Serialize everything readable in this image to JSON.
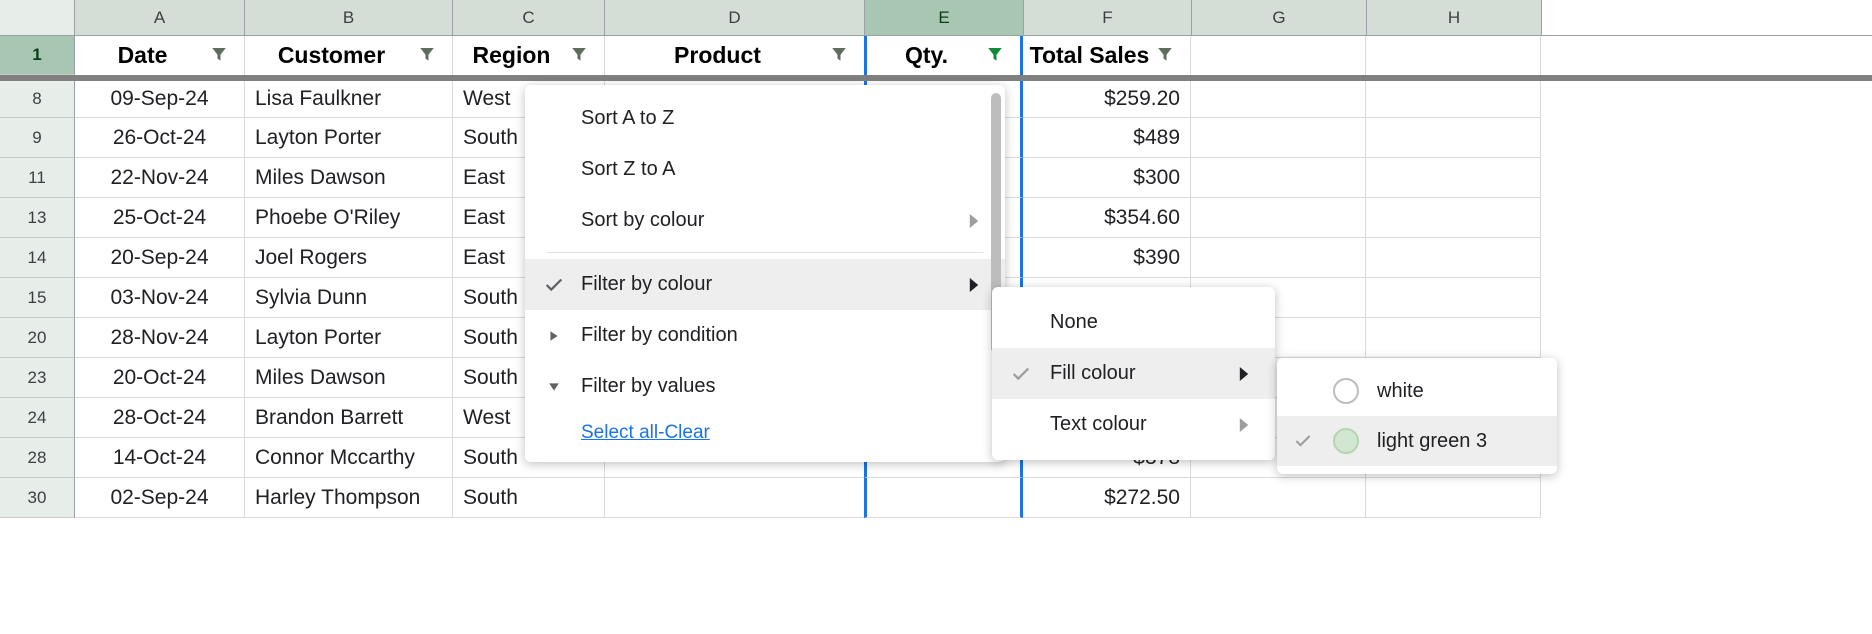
{
  "columns": [
    "A",
    "B",
    "C",
    "D",
    "E",
    "F",
    "G",
    "H"
  ],
  "column_widths": [
    "w-a",
    "w-b",
    "w-c",
    "w-d",
    "w-e",
    "w-f",
    "w-g",
    "w-h"
  ],
  "selected_col_index": 4,
  "header_row_num": "1",
  "headers": [
    {
      "label": "Date",
      "filter": "normal"
    },
    {
      "label": "Customer",
      "filter": "normal"
    },
    {
      "label": "Region",
      "filter": "normal"
    },
    {
      "label": "Product",
      "filter": "normal"
    },
    {
      "label": "Qty.",
      "filter": "active"
    },
    {
      "label": "Total Sales",
      "filter": "normal"
    }
  ],
  "rows": [
    {
      "n": "8",
      "date": "09-Sep-24",
      "customer": "Lisa Faulkner",
      "region": "West",
      "total": "$259.20"
    },
    {
      "n": "9",
      "date": "26-Oct-24",
      "customer": "Layton Porter",
      "region": "South",
      "total": "$489"
    },
    {
      "n": "11",
      "date": "22-Nov-24",
      "customer": "Miles Dawson",
      "region": "East",
      "total": "$300"
    },
    {
      "n": "13",
      "date": "25-Oct-24",
      "customer": "Phoebe O'Riley",
      "region": "East",
      "total": "$354.60"
    },
    {
      "n": "14",
      "date": "20-Sep-24",
      "customer": "Joel Rogers",
      "region": "East",
      "total": "$390"
    },
    {
      "n": "15",
      "date": "03-Nov-24",
      "customer": "Sylvia Dunn",
      "region": "South",
      "total": ""
    },
    {
      "n": "20",
      "date": "28-Nov-24",
      "customer": "Layton Porter",
      "region": "South",
      "total": ""
    },
    {
      "n": "23",
      "date": "20-Oct-24",
      "customer": "Miles Dawson",
      "region": "South",
      "total": ""
    },
    {
      "n": "24",
      "date": "28-Oct-24",
      "customer": "Brandon Barrett",
      "region": "West",
      "total": ""
    },
    {
      "n": "28",
      "date": "14-Oct-24",
      "customer": "Connor Mccarthy",
      "region": "South",
      "total": "$378"
    },
    {
      "n": "30",
      "date": "02-Sep-24",
      "customer": "Harley Thompson",
      "region": "South",
      "total": "$272.50"
    }
  ],
  "menu1": {
    "sort_az": "Sort A to Z",
    "sort_za": "Sort Z to A",
    "sort_colour": "Sort by colour",
    "filter_colour": "Filter by colour",
    "filter_condition": "Filter by condition",
    "filter_values": "Filter by values",
    "select_all": "Select all",
    "clear": "Clear"
  },
  "menu2": {
    "none": "None",
    "fill": "Fill colour",
    "text": "Text colour"
  },
  "menu3": {
    "white": "white",
    "lg3": "light green 3"
  }
}
